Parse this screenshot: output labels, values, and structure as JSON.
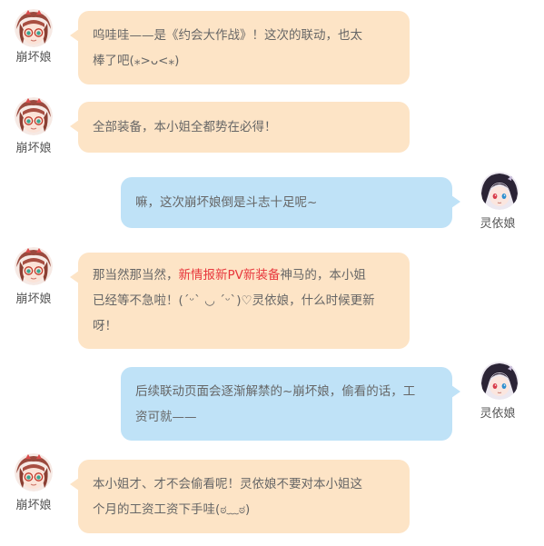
{
  "speakers": {
    "benghuai": {
      "name": "崩坏娘"
    },
    "lingyi": {
      "name": "灵依娘"
    }
  },
  "colors": {
    "left_bubble": "#fde4c6",
    "right_bubble": "#bfe2f7",
    "highlight": "#e8383d",
    "text": "#666666"
  },
  "messages": [
    {
      "speaker": "崩坏娘",
      "side": "left",
      "line1": "呜哇哇——是《约会大作战》！这次的联动，也太",
      "line2": "棒了吧(⁎>ᴗ<⁎)"
    },
    {
      "speaker": "崩坏娘",
      "side": "left",
      "line1": "全部装备，本小姐全都势在必得！"
    },
    {
      "speaker": "灵依娘",
      "side": "right",
      "line1": "嘛，这次崩坏娘倒是斗志十足呢~"
    },
    {
      "speaker": "崩坏娘",
      "side": "left",
      "line1_pre": "那当然那当然，",
      "line1_highlight": "新情报新PV新装备",
      "line1_post": "神马的，本小姐",
      "line2": "已经等不急啦！(´ᵕ` ◡ ´ᵕ`)♡灵依娘，什么时候更新",
      "line3": "呀！"
    },
    {
      "speaker": "灵依娘",
      "side": "right",
      "line1": "后续联动页面会逐渐解禁的~崩坏娘，偷看的话，工",
      "line2": "资可就——"
    },
    {
      "speaker": "崩坏娘",
      "side": "left",
      "line1": "本小姐才、才不会偷看呢！灵依娘不要对本小姐这",
      "line2": "个月的工资工资下手哇(ಠ﹏ಠ)"
    }
  ]
}
